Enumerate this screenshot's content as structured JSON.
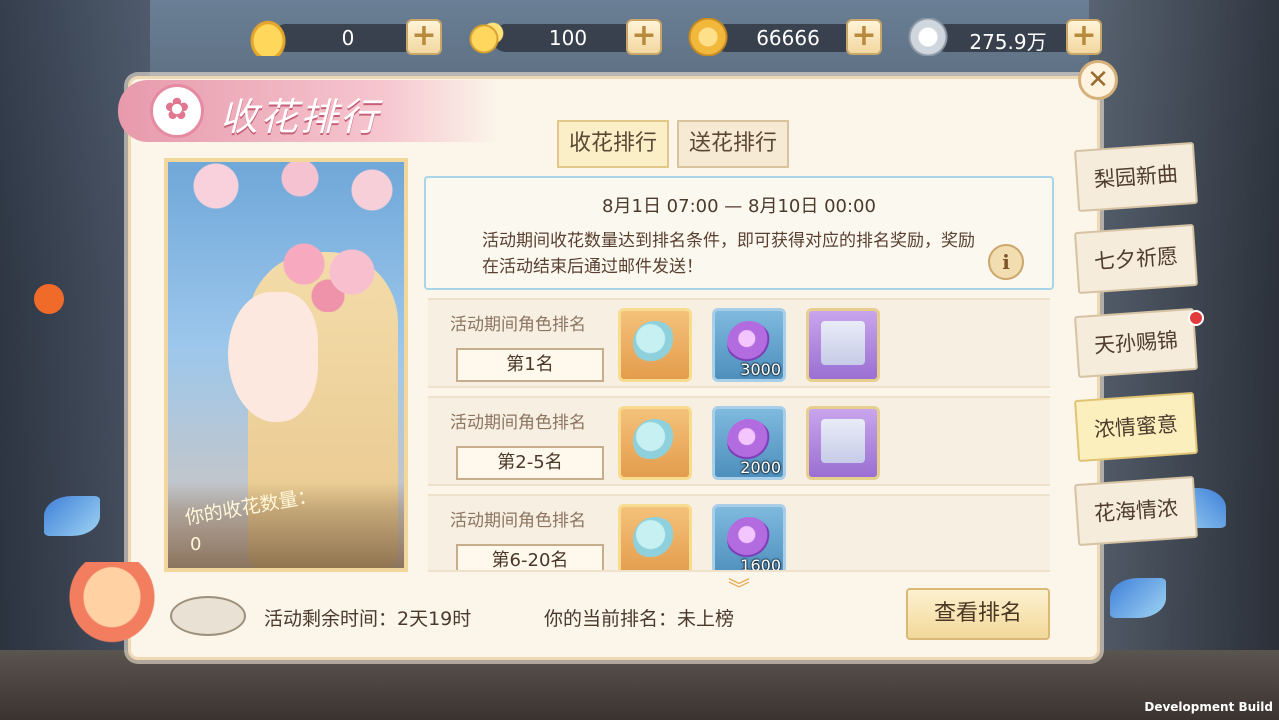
{
  "currency": [
    {
      "icon": "gold-ingot-icon",
      "value": "0"
    },
    {
      "icon": "gold-beans-icon",
      "value": "100"
    },
    {
      "icon": "gold-coin-icon",
      "value": "66666"
    },
    {
      "icon": "silver-coin-icon",
      "value": "275.9万"
    }
  ],
  "plus_glyph": "+",
  "title": "收花排行",
  "close_glyph": "✕",
  "tabs": {
    "receive": "收花排行",
    "send": "送花排行"
  },
  "portrait": {
    "label": "你的收花数量：",
    "count": "0"
  },
  "info": {
    "date_range": "8月1日 07:00 — 8月10日 00:00",
    "description": "活动期间收花数量达到排名条件，即可获得对应的排名奖励，奖励在活动结束后通过邮件发送！",
    "info_glyph": "i"
  },
  "rows": [
    {
      "label": "活动期间角色排名",
      "rank": "第1名",
      "items": [
        {
          "type": "key"
        },
        {
          "type": "orb",
          "qty": "3000"
        },
        {
          "type": "scroll"
        }
      ]
    },
    {
      "label": "活动期间角色排名",
      "rank": "第2-5名",
      "items": [
        {
          "type": "key"
        },
        {
          "type": "orb",
          "qty": "2000"
        },
        {
          "type": "scroll"
        }
      ]
    },
    {
      "label": "活动期间角色排名",
      "rank": "第6-20名",
      "items": [
        {
          "type": "key"
        },
        {
          "type": "orb",
          "qty": "1600"
        }
      ]
    }
  ],
  "footer": {
    "remaining": "活动剩余时间：2天19时",
    "current_rank": "你的当前排名：未上榜",
    "view_button": "查看排名",
    "more_glyph": "︾"
  },
  "side_tabs": [
    "梨园新曲",
    "七夕祈愿",
    "天孙赐锦",
    "浓情蜜意",
    "花海情浓"
  ],
  "active_side_tab": "浓情蜜意",
  "dev_build": "Development Build"
}
